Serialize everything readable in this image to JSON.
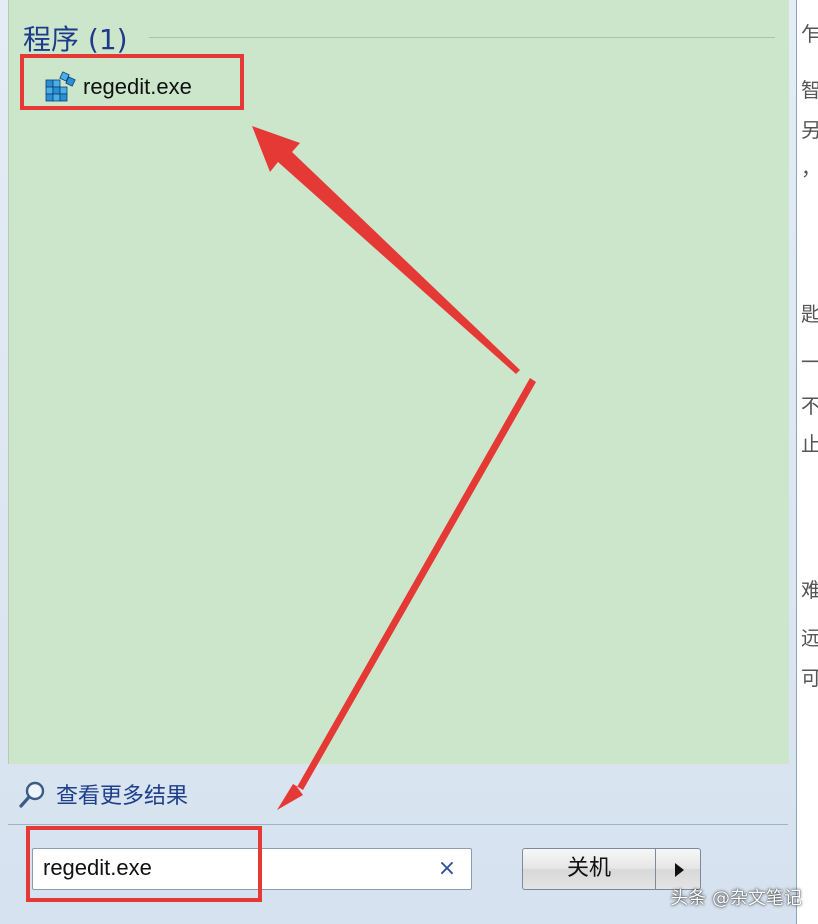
{
  "results": {
    "section_title": "程序 (1)",
    "items": [
      {
        "label": "regedit.exe",
        "icon": "registry-editor-icon"
      }
    ],
    "more_results_label": "查看更多结果",
    "more_results_icon": "search-icon"
  },
  "search": {
    "value": "regedit.exe",
    "clear_glyph": "×"
  },
  "power": {
    "shutdown_label": "关机",
    "options_icon": "chevron-right-icon"
  },
  "right_strip_chars": [
    "乍",
    "智",
    "另",
    "，",
    "匙",
    "一",
    "不",
    "止",
    "难",
    "远",
    "可"
  ],
  "watermark": "头条 @杂文笔记",
  "colors": {
    "results_bg": "#cce6cc",
    "annotation_red": "#e53935",
    "header_text": "#1e3a8a"
  }
}
